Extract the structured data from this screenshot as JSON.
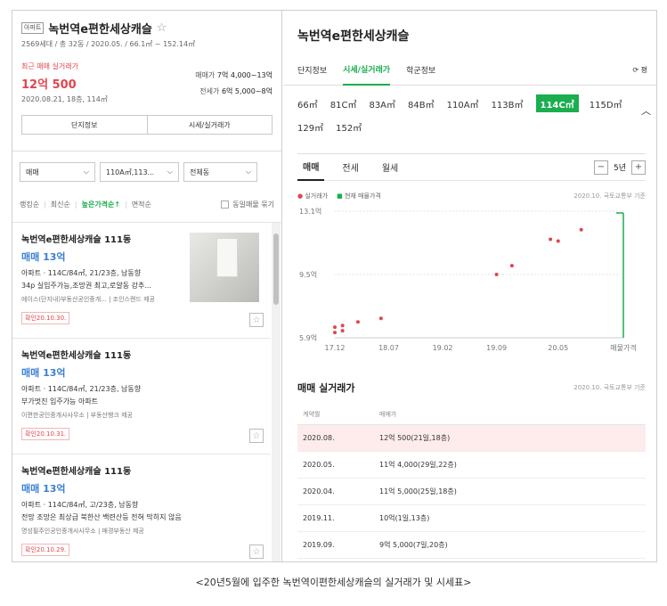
{
  "left": {
    "badge": "아파트",
    "title": "녹번역e편한세상캐슬",
    "meta": "2569세대 / 총 32동 / 2020.05. / 66.1㎡ ~ 152.14㎡",
    "recent_label": "최근 매매 실거래가",
    "recent_price": "12억 500",
    "recent_date": "2020.08.21, 18층, 114㎡",
    "sale_range_label": "매매가",
    "sale_range": "7억 4,000~13억",
    "jeonse_range_label": "전세가",
    "jeonse_range": "6억 5,000~8억",
    "btn_complex": "단지정보",
    "btn_price": "시세/실거래가",
    "filters": {
      "type": "매매",
      "area": "110A㎡,113...",
      "building": "전체동"
    },
    "sort": {
      "rank": "랭킹순",
      "latest": "최신순",
      "high_price": "높은가격순↑",
      "area": "면적순",
      "same_listing": "동일매물 묶기"
    },
    "listings": [
      {
        "title": "녹번역e편한세상캐슬 111동",
        "price": "매매 13억",
        "spec": "아파트 · 114C/84㎡, 21/23층, 남동향",
        "desc": "34p 실입주가능,조망권 최고,로얄동 강추...",
        "agent": "에이스(단지내)부동산공인중개... | 조인스랜드 제공",
        "confirm": "확인20.10.30."
      },
      {
        "title": "녹번역e편한세상캐슬 111동",
        "price": "매매 13억",
        "spec": "아파트 · 114C/84㎡, 21/23층, 남동향",
        "desc": "부가멋진 입주가능 아파트",
        "agent": "이편한공인중개사사무소 | 부동산뱅크 제공",
        "confirm": "확인20.10.31."
      },
      {
        "title": "녹번역e편한세상캐슬 111동",
        "price": "매매 13억",
        "spec": "아파트 · 114C/84㎡, 고/23층, 남동향",
        "desc": "전망 조망은 최상급 북한산 백련산등 전혀 막히지 않음",
        "agent": "명성필주인공인중개사사무소 | 매경부동산 제공",
        "confirm": "확인20.10.29."
      }
    ]
  },
  "right": {
    "title": "녹번역e편한세상캐슬",
    "tabs": [
      "단지정보",
      "시세/실거래가",
      "학군정보"
    ],
    "refresh": "⟳ 평",
    "areas": [
      "66㎡",
      "81C㎡",
      "83A㎡",
      "84B㎡",
      "110A㎡",
      "113B㎡",
      "114C㎡",
      "115D㎡",
      "129㎡",
      "152㎡"
    ],
    "chart_tabs": [
      "매매",
      "전세",
      "월세"
    ],
    "period": "5년",
    "legend_actual": "실거래가",
    "legend_current": "현재 매물가격",
    "chart_source": "2020.10. 국토교통부 기준",
    "tx_title": "매매 실거래가",
    "tx_source": "2020.10. 국토교통부 기준",
    "tx_headers": [
      "계약월",
      "매매가"
    ],
    "tx_rows": [
      [
        "2020.08.",
        "12억 500(21일,18층)"
      ],
      [
        "2020.05.",
        "11억 4,000(29일,22층)"
      ],
      [
        "2020.04.",
        "11억 5,000(25일,18층)"
      ],
      [
        "2019.11.",
        "10억(1일,13층)"
      ],
      [
        "2019.09.",
        "9억 5,000(7일,20층)"
      ]
    ]
  },
  "caption": "<20년5월에 입주한 녹번역이편한세상캐슬의 실거래가 및 시세표>",
  "colors": {
    "accent_green": "#1aae4f",
    "price_red": "#e0464d",
    "listing_blue": "#3a7fd1"
  },
  "chart_data": {
    "type": "scatter",
    "title": "",
    "xlabel": "",
    "ylabel": "",
    "x_ticks": [
      "17.12",
      "18.07",
      "19.02",
      "19.09",
      "20.05",
      "매물가격"
    ],
    "y_ticks": [
      "13.1억",
      "9.5억",
      "5.9억"
    ],
    "ylim": [
      5.9,
      13.1
    ],
    "series": [
      {
        "name": "실거래가",
        "color": "#e0464d",
        "points": [
          [
            "2017.12",
            6.2
          ],
          [
            "2017.12",
            6.5
          ],
          [
            "2018.01",
            6.3
          ],
          [
            "2018.01",
            6.6
          ],
          [
            "2018.03",
            6.8
          ],
          [
            "2018.06",
            7.0
          ],
          [
            "2019.09",
            9.5
          ],
          [
            "2019.11",
            10.0
          ],
          [
            "2020.04",
            11.5
          ],
          [
            "2020.05",
            11.4
          ],
          [
            "2020.08",
            12.05
          ]
        ]
      },
      {
        "name": "현재 매물가격",
        "color": "#1aae4f",
        "range": [
          5.9,
          13.0
        ]
      }
    ]
  }
}
